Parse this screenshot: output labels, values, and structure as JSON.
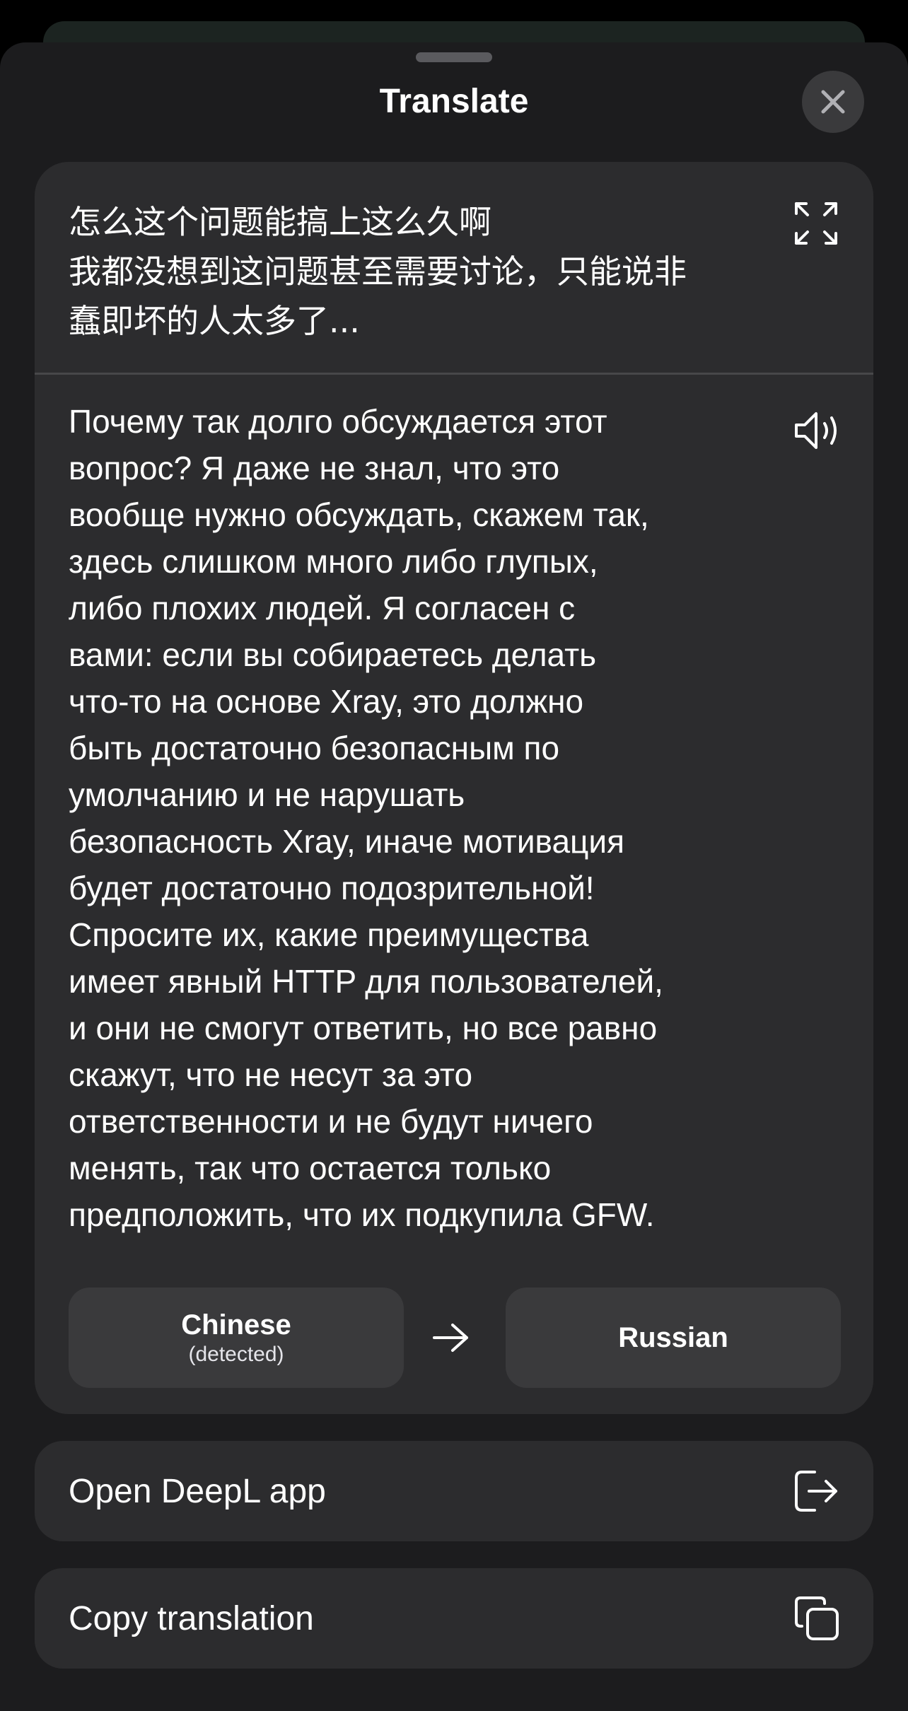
{
  "header": {
    "title": "Translate"
  },
  "source": {
    "text": "怎么这个问题能搞上这么久啊\n我都没想到这问题甚至需要讨论，只能说非\n蠢即坏的人太多了..."
  },
  "translation": {
    "text": "Почему так долго обсуждается этот\nвопрос? Я даже не знал, что это\nвообще нужно обсуждать, скажем так,\nздесь слишком много либо глупых,\nлибо плохих людей. Я согласен с\nвами: если вы собираетесь делать\nчто-то на основе Xray, это должно\nбыть достаточно безопасным по\nумолчанию и не нарушать\nбезопасность Xray, иначе мотивация\nбудет достаточно подозрительной!\nСпросите их, какие преимущества\nимеет явный HTTP для пользователей,\nи они не смогут ответить, но все равно\nскажут, что не несут за это\nответственности и не будут ничего\nменять, так что остается только\nпредположить, что их подкупила GFW."
  },
  "languages": {
    "source_name": "Chinese",
    "source_note": "(detected)",
    "target_name": "Russian"
  },
  "actions": {
    "open_app_label": "Open DeepL app",
    "copy_label": "Copy translation"
  },
  "icons": {
    "close": "close-icon",
    "expand": "expand-icon",
    "speaker": "speaker-icon",
    "arrow": "arrow-right-icon",
    "open_app": "open-external-icon",
    "copy": "copy-icon"
  },
  "colors": {
    "background": "#000000",
    "sheet": "#1c1c1e",
    "card": "#2c2c2e",
    "button": "#3a3a3c",
    "text": "#ffffff"
  }
}
